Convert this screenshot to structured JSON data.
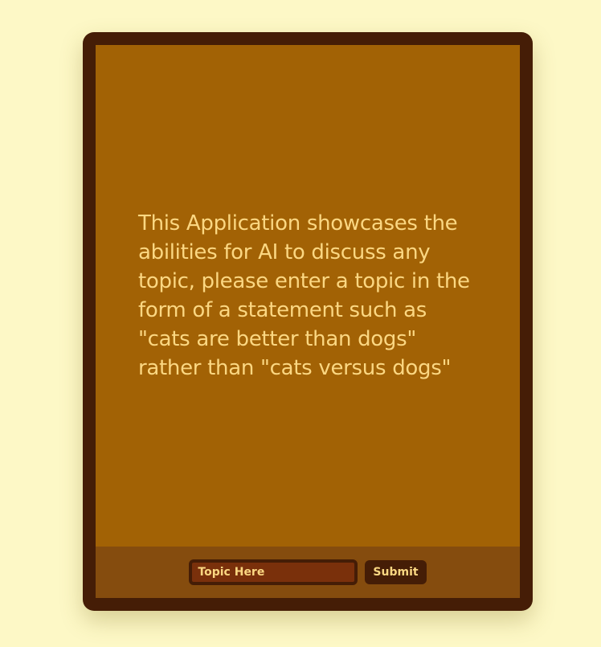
{
  "app": {
    "intro_text": "This Application showcases the abilities for AI to discuss any topic, please enter a topic in the form of a statement such as \"cats are better than dogs\" rather than \"cats versus dogs\""
  },
  "form": {
    "topic_input": {
      "placeholder": "Topic Here",
      "value": ""
    },
    "submit_label": "Submit"
  },
  "colors": {
    "page_background": "#fdf8c6",
    "frame": "#451d06",
    "screen_background": "#a26205",
    "input_bar_background": "#854c0e",
    "input_field_background": "#7a300b",
    "text": "#fbd782"
  }
}
